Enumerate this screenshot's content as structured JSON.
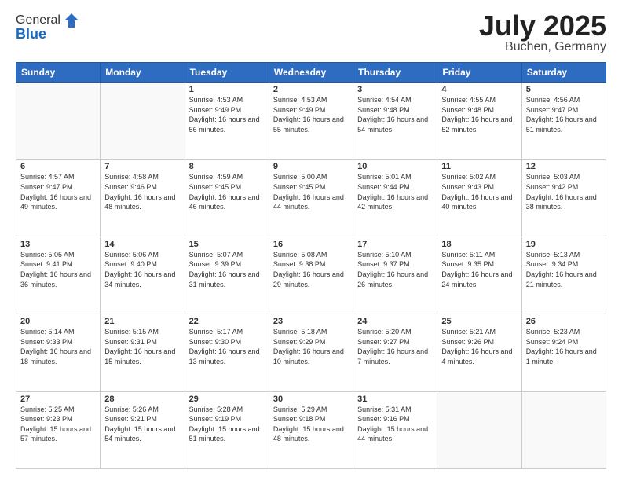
{
  "header": {
    "logo_general": "General",
    "logo_blue": "Blue",
    "month_year": "July 2025",
    "location": "Buchen, Germany"
  },
  "weekdays": [
    "Sunday",
    "Monday",
    "Tuesday",
    "Wednesday",
    "Thursday",
    "Friday",
    "Saturday"
  ],
  "weeks": [
    [
      {
        "num": "",
        "sunrise": "",
        "sunset": "",
        "daylight": ""
      },
      {
        "num": "",
        "sunrise": "",
        "sunset": "",
        "daylight": ""
      },
      {
        "num": "1",
        "sunrise": "Sunrise: 4:53 AM",
        "sunset": "Sunset: 9:49 PM",
        "daylight": "Daylight: 16 hours and 56 minutes."
      },
      {
        "num": "2",
        "sunrise": "Sunrise: 4:53 AM",
        "sunset": "Sunset: 9:49 PM",
        "daylight": "Daylight: 16 hours and 55 minutes."
      },
      {
        "num": "3",
        "sunrise": "Sunrise: 4:54 AM",
        "sunset": "Sunset: 9:48 PM",
        "daylight": "Daylight: 16 hours and 54 minutes."
      },
      {
        "num": "4",
        "sunrise": "Sunrise: 4:55 AM",
        "sunset": "Sunset: 9:48 PM",
        "daylight": "Daylight: 16 hours and 52 minutes."
      },
      {
        "num": "5",
        "sunrise": "Sunrise: 4:56 AM",
        "sunset": "Sunset: 9:47 PM",
        "daylight": "Daylight: 16 hours and 51 minutes."
      }
    ],
    [
      {
        "num": "6",
        "sunrise": "Sunrise: 4:57 AM",
        "sunset": "Sunset: 9:47 PM",
        "daylight": "Daylight: 16 hours and 49 minutes."
      },
      {
        "num": "7",
        "sunrise": "Sunrise: 4:58 AM",
        "sunset": "Sunset: 9:46 PM",
        "daylight": "Daylight: 16 hours and 48 minutes."
      },
      {
        "num": "8",
        "sunrise": "Sunrise: 4:59 AM",
        "sunset": "Sunset: 9:45 PM",
        "daylight": "Daylight: 16 hours and 46 minutes."
      },
      {
        "num": "9",
        "sunrise": "Sunrise: 5:00 AM",
        "sunset": "Sunset: 9:45 PM",
        "daylight": "Daylight: 16 hours and 44 minutes."
      },
      {
        "num": "10",
        "sunrise": "Sunrise: 5:01 AM",
        "sunset": "Sunset: 9:44 PM",
        "daylight": "Daylight: 16 hours and 42 minutes."
      },
      {
        "num": "11",
        "sunrise": "Sunrise: 5:02 AM",
        "sunset": "Sunset: 9:43 PM",
        "daylight": "Daylight: 16 hours and 40 minutes."
      },
      {
        "num": "12",
        "sunrise": "Sunrise: 5:03 AM",
        "sunset": "Sunset: 9:42 PM",
        "daylight": "Daylight: 16 hours and 38 minutes."
      }
    ],
    [
      {
        "num": "13",
        "sunrise": "Sunrise: 5:05 AM",
        "sunset": "Sunset: 9:41 PM",
        "daylight": "Daylight: 16 hours and 36 minutes."
      },
      {
        "num": "14",
        "sunrise": "Sunrise: 5:06 AM",
        "sunset": "Sunset: 9:40 PM",
        "daylight": "Daylight: 16 hours and 34 minutes."
      },
      {
        "num": "15",
        "sunrise": "Sunrise: 5:07 AM",
        "sunset": "Sunset: 9:39 PM",
        "daylight": "Daylight: 16 hours and 31 minutes."
      },
      {
        "num": "16",
        "sunrise": "Sunrise: 5:08 AM",
        "sunset": "Sunset: 9:38 PM",
        "daylight": "Daylight: 16 hours and 29 minutes."
      },
      {
        "num": "17",
        "sunrise": "Sunrise: 5:10 AM",
        "sunset": "Sunset: 9:37 PM",
        "daylight": "Daylight: 16 hours and 26 minutes."
      },
      {
        "num": "18",
        "sunrise": "Sunrise: 5:11 AM",
        "sunset": "Sunset: 9:35 PM",
        "daylight": "Daylight: 16 hours and 24 minutes."
      },
      {
        "num": "19",
        "sunrise": "Sunrise: 5:13 AM",
        "sunset": "Sunset: 9:34 PM",
        "daylight": "Daylight: 16 hours and 21 minutes."
      }
    ],
    [
      {
        "num": "20",
        "sunrise": "Sunrise: 5:14 AM",
        "sunset": "Sunset: 9:33 PM",
        "daylight": "Daylight: 16 hours and 18 minutes."
      },
      {
        "num": "21",
        "sunrise": "Sunrise: 5:15 AM",
        "sunset": "Sunset: 9:31 PM",
        "daylight": "Daylight: 16 hours and 15 minutes."
      },
      {
        "num": "22",
        "sunrise": "Sunrise: 5:17 AM",
        "sunset": "Sunset: 9:30 PM",
        "daylight": "Daylight: 16 hours and 13 minutes."
      },
      {
        "num": "23",
        "sunrise": "Sunrise: 5:18 AM",
        "sunset": "Sunset: 9:29 PM",
        "daylight": "Daylight: 16 hours and 10 minutes."
      },
      {
        "num": "24",
        "sunrise": "Sunrise: 5:20 AM",
        "sunset": "Sunset: 9:27 PM",
        "daylight": "Daylight: 16 hours and 7 minutes."
      },
      {
        "num": "25",
        "sunrise": "Sunrise: 5:21 AM",
        "sunset": "Sunset: 9:26 PM",
        "daylight": "Daylight: 16 hours and 4 minutes."
      },
      {
        "num": "26",
        "sunrise": "Sunrise: 5:23 AM",
        "sunset": "Sunset: 9:24 PM",
        "daylight": "Daylight: 16 hours and 1 minute."
      }
    ],
    [
      {
        "num": "27",
        "sunrise": "Sunrise: 5:25 AM",
        "sunset": "Sunset: 9:23 PM",
        "daylight": "Daylight: 15 hours and 57 minutes."
      },
      {
        "num": "28",
        "sunrise": "Sunrise: 5:26 AM",
        "sunset": "Sunset: 9:21 PM",
        "daylight": "Daylight: 15 hours and 54 minutes."
      },
      {
        "num": "29",
        "sunrise": "Sunrise: 5:28 AM",
        "sunset": "Sunset: 9:19 PM",
        "daylight": "Daylight: 15 hours and 51 minutes."
      },
      {
        "num": "30",
        "sunrise": "Sunrise: 5:29 AM",
        "sunset": "Sunset: 9:18 PM",
        "daylight": "Daylight: 15 hours and 48 minutes."
      },
      {
        "num": "31",
        "sunrise": "Sunrise: 5:31 AM",
        "sunset": "Sunset: 9:16 PM",
        "daylight": "Daylight: 15 hours and 44 minutes."
      },
      {
        "num": "",
        "sunrise": "",
        "sunset": "",
        "daylight": ""
      },
      {
        "num": "",
        "sunrise": "",
        "sunset": "",
        "daylight": ""
      }
    ]
  ]
}
